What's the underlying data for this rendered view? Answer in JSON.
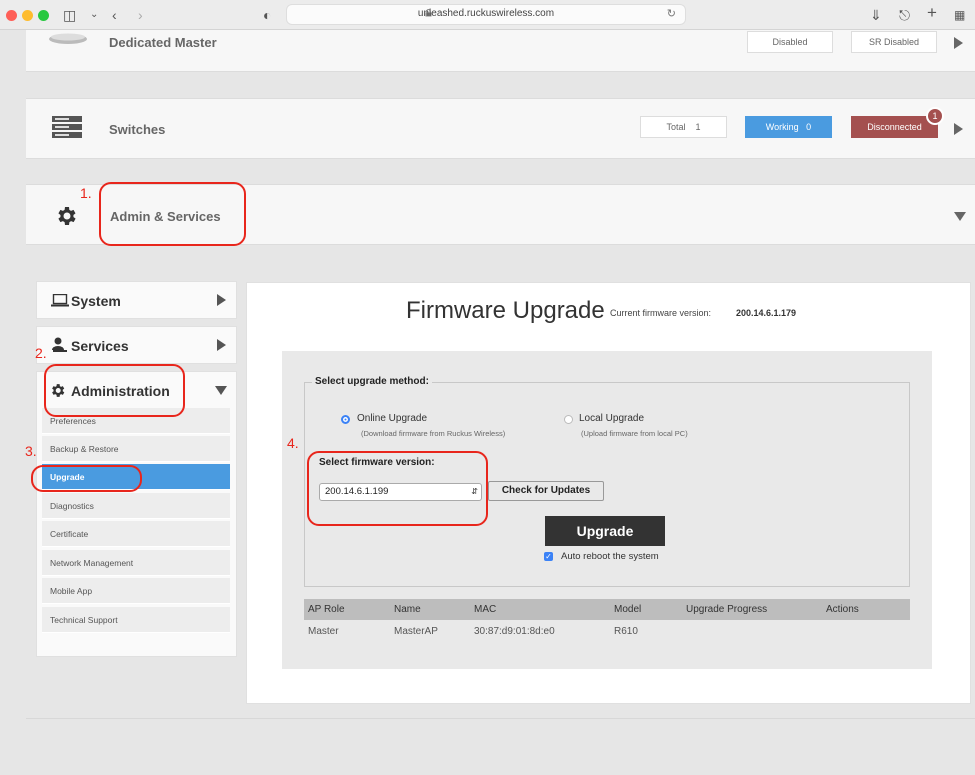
{
  "browser": {
    "url": "unleashed.ruckuswireless.com",
    "traffic_colors": [
      "#fe5f57",
      "#febc2e",
      "#28c840"
    ]
  },
  "dedicated_master": {
    "title": "Dedicated Master",
    "status_1": "Disabled",
    "status_2": "SR Disabled"
  },
  "switches": {
    "title": "Switches",
    "total_label": "Total",
    "total_value": "1",
    "working_label": "Working",
    "working_value": "0",
    "disconnected_label": "Disconnected",
    "badge": "1"
  },
  "admin_services": {
    "title": "Admin & Services"
  },
  "nav": {
    "system": "System",
    "services": "Services",
    "administration": "Administration",
    "sub_items": [
      "Preferences",
      "Backup & Restore",
      "Upgrade",
      "Diagnostics",
      "Certificate",
      "Network Management",
      "Mobile App",
      "Technical Support"
    ]
  },
  "firmware": {
    "title": "Firmware Upgrade",
    "current_label": "Current firmware version:",
    "current_value": "200.14.6.1.179",
    "method_legend": "Select upgrade method:",
    "online_label": "Online Upgrade",
    "online_desc": "(Download firmware from Ruckus Wireless)",
    "local_label": "Local Upgrade",
    "local_desc": "(Upload firmware from local PC)",
    "select_version_label": "Select firmware version:",
    "selected_version": "200.14.6.1.199",
    "check_button": "Check for Updates",
    "upgrade_button": "Upgrade",
    "auto_reboot_label": "Auto reboot the system"
  },
  "ap_table": {
    "headers": [
      "AP Role",
      "Name",
      "MAC",
      "Model",
      "Upgrade Progress",
      "Actions"
    ],
    "rows": [
      [
        "Master",
        "MasterAP",
        "30:87:d9:01:8d:e0",
        "R610",
        "",
        ""
      ]
    ]
  },
  "annotations": [
    "1.",
    "2.",
    "3.",
    "4."
  ],
  "colors": {
    "annotation_red": "#e8261c",
    "working_blue": "#4a9be0",
    "disconnected_red": "#a4504f",
    "upgrade_button_bg": "#333333"
  }
}
